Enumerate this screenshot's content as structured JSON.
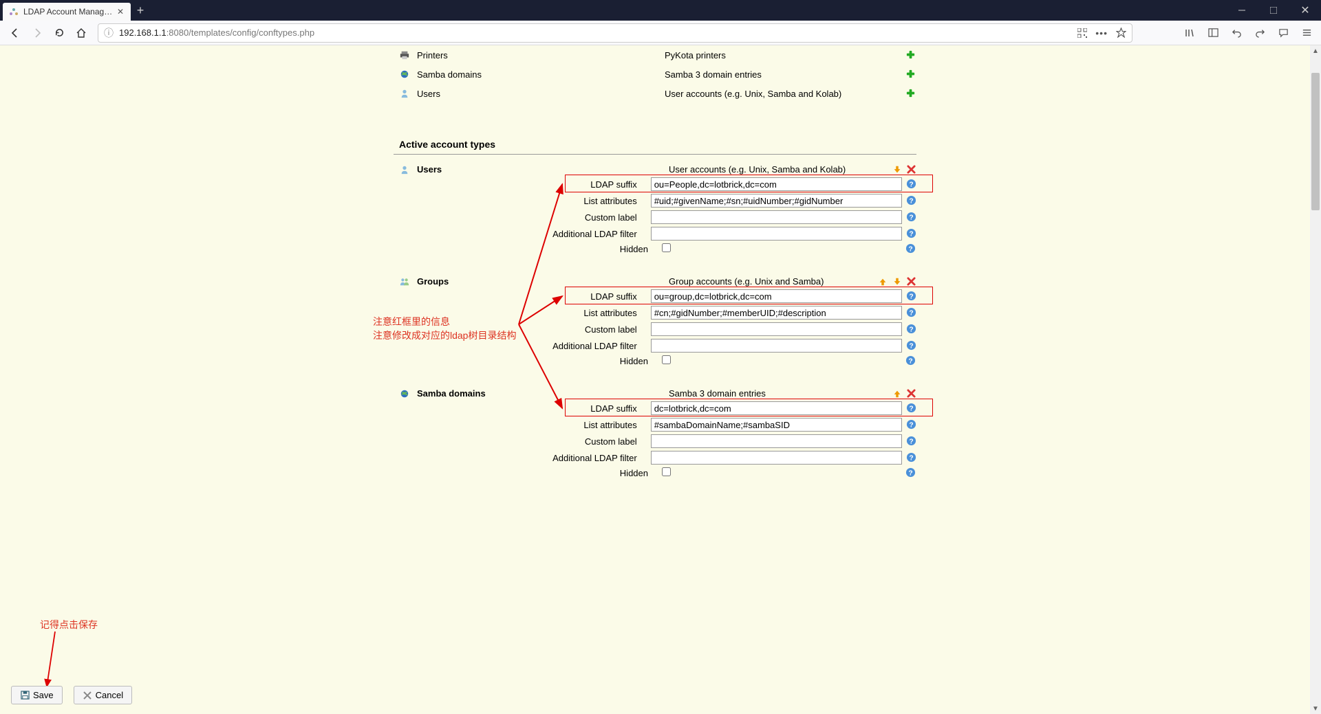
{
  "browser": {
    "tab_title": "LDAP Account Manager Con",
    "url_prefix": "192.168.1.1",
    "url_rest": ":8080/templates/config/conftypes.php"
  },
  "available_types": [
    {
      "icon": "printer",
      "name": "Printers",
      "desc": "PyKota printers"
    },
    {
      "icon": "globe",
      "name": "Samba domains",
      "desc": "Samba 3 domain entries"
    },
    {
      "icon": "user",
      "name": "Users",
      "desc": "User accounts (e.g. Unix, Samba and Kolab)"
    }
  ],
  "section_active_title": "Active account types",
  "labels": {
    "ldap_suffix": "LDAP suffix",
    "list_attributes": "List attributes",
    "custom_label": "Custom label",
    "additional_filter": "Additional LDAP filter",
    "hidden": "Hidden"
  },
  "active": [
    {
      "icon": "user",
      "name": "Users",
      "desc": "User accounts (e.g. Unix, Samba and Kolab)",
      "actions": [
        "down",
        "delete"
      ],
      "suffix": "ou=People,dc=lotbrick,dc=com",
      "list_attrs": "#uid;#givenName;#sn;#uidNumber;#gidNumber",
      "custom": "",
      "filter": "",
      "hidden": false
    },
    {
      "icon": "group",
      "name": "Groups",
      "desc": "Group accounts (e.g. Unix and Samba)",
      "actions": [
        "up",
        "down",
        "delete"
      ],
      "suffix": "ou=group,dc=lotbrick,dc=com",
      "list_attrs": "#cn;#gidNumber;#memberUID;#description",
      "custom": "",
      "filter": "",
      "hidden": false
    },
    {
      "icon": "globe",
      "name": "Samba domains",
      "desc": "Samba 3 domain entries",
      "actions": [
        "up",
        "delete"
      ],
      "suffix": "dc=lotbrick,dc=com",
      "list_attrs": "#sambaDomainName;#sambaSID",
      "custom": "",
      "filter": "",
      "hidden": false
    }
  ],
  "buttons": {
    "save": "Save",
    "cancel": "Cancel"
  },
  "annotations": {
    "line1": "注意红框里的信息",
    "line2": "注意修改成对应的ldap树目录结构",
    "save_note": "记得点击保存"
  }
}
